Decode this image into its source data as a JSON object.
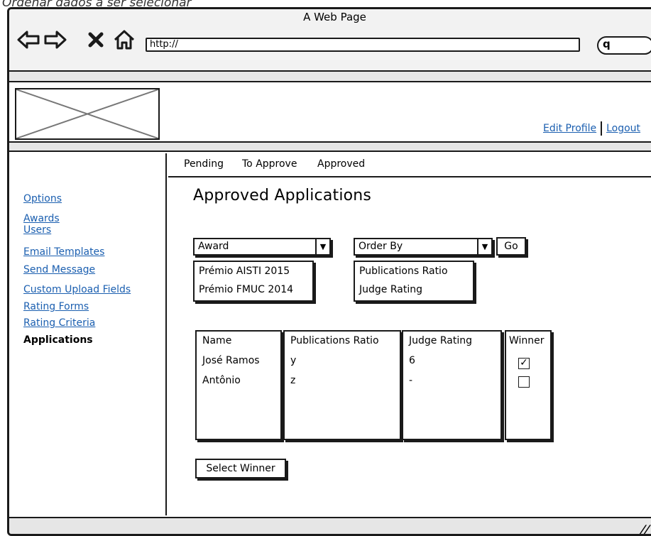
{
  "caption": "Ordenar dados a ser selecionar",
  "browser": {
    "title": "A Web Page",
    "url": "http://",
    "search_icon_glyph": "q"
  },
  "icons": {
    "back": "back-arrow-icon",
    "forward": "forward-arrow-icon",
    "stop": "close-icon",
    "home": "home-icon"
  },
  "header": {
    "edit_profile": "Edit Profile",
    "logout": "Logout"
  },
  "sidebar": {
    "items": [
      {
        "label": "Options"
      },
      {
        "label": "Awards"
      },
      {
        "label": "Users"
      },
      {
        "label": "Email Templates"
      },
      {
        "label": "Send Message"
      },
      {
        "label": "Custom Upload Fields"
      },
      {
        "label": "Rating Forms"
      },
      {
        "label": "Rating Criteria"
      },
      {
        "label": "Applications"
      }
    ],
    "active": "Applications"
  },
  "tabs": [
    {
      "label": "Pending"
    },
    {
      "label": "To Approve"
    },
    {
      "label": "Approved"
    }
  ],
  "main": {
    "title": "Approved Applications",
    "award_select": {
      "value": "Award",
      "options": [
        "Prémio AISTI 2015",
        "Prémio FMUC 2014"
      ]
    },
    "order_select": {
      "value": "Order By",
      "options": [
        "Publications Ratio",
        "Judge Rating"
      ]
    },
    "go_label": "Go",
    "table": {
      "headers": [
        "Name",
        "Publications Ratio",
        "Judge Rating",
        "Winner"
      ],
      "rows": [
        {
          "name": "José Ramos",
          "ratio": "y",
          "rating": "6",
          "winner": true
        },
        {
          "name": "Antônio",
          "ratio": "z",
          "rating": "-",
          "winner": false
        }
      ]
    },
    "select_winner_label": "Select Winner"
  },
  "colors": {
    "link": "#1b5fb0",
    "border": "#1a1a1a",
    "chrome": "#f2f2f2"
  }
}
